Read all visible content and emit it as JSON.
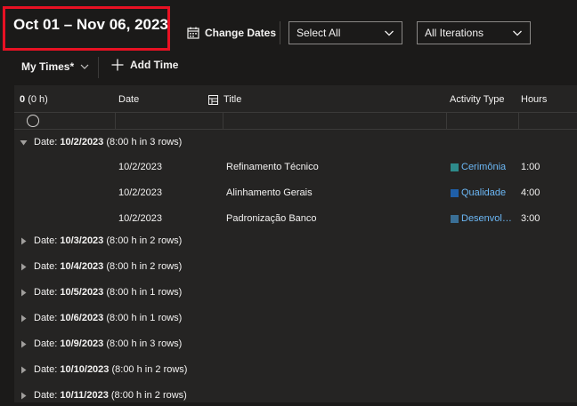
{
  "header": {
    "date_range": "Oct 01 – Nov 06, 2023",
    "change_dates_label": "Change Dates",
    "select_all_label": "Select All",
    "iterations_label": "All Iterations"
  },
  "command_bar": {
    "my_times_label": "My Times*",
    "add_time_label": "Add Time"
  },
  "grid": {
    "header": {
      "count_value": "0",
      "count_hours": "(0 h)",
      "date": "Date",
      "title": "Title",
      "activity_type": "Activity Type",
      "hours": "Hours"
    },
    "groups": [
      {
        "prefix": "Date: ",
        "date": "10/2/2023",
        "summary": " (8:00 h in 3 rows)",
        "expanded": true,
        "items": [
          {
            "date": "10/2/2023",
            "title": "Refinamento Técnico",
            "activity": "Cerimônia",
            "activity_color": "#2e8b8b",
            "hours": "1:00"
          },
          {
            "date": "10/2/2023",
            "title": "Alinhamento Gerais",
            "activity": "Qualidade",
            "activity_color": "#1f5fa8",
            "hours": "4:00"
          },
          {
            "date": "10/2/2023",
            "title": "Padronização Banco",
            "activity": "Desenvolv…",
            "activity_color": "#3a6f96",
            "hours": "3:00"
          }
        ]
      },
      {
        "prefix": "Date: ",
        "date": "10/3/2023",
        "summary": " (8:00 h in 2 rows)",
        "expanded": false
      },
      {
        "prefix": "Date: ",
        "date": "10/4/2023",
        "summary": " (8:00 h in 2 rows)",
        "expanded": false
      },
      {
        "prefix": "Date: ",
        "date": "10/5/2023",
        "summary": " (8:00 h in 1 rows)",
        "expanded": false
      },
      {
        "prefix": "Date: ",
        "date": "10/6/2023",
        "summary": " (8:00 h in 1 rows)",
        "expanded": false
      },
      {
        "prefix": "Date: ",
        "date": "10/9/2023",
        "summary": " (8:00 h in 3 rows)",
        "expanded": false
      },
      {
        "prefix": "Date: ",
        "date": "10/10/2023",
        "summary": " (8:00 h in 2 rows)",
        "expanded": false
      },
      {
        "prefix": "Date: ",
        "date": "10/11/2023",
        "summary": " (8:00 h in 2 rows)",
        "expanded": false
      }
    ]
  },
  "icons": {
    "calendar": "calendar-icon",
    "chevron": "chevron-down-icon",
    "plus": "plus-icon",
    "title_column": "column-options-icon",
    "expand": "triangle-right-icon",
    "collapse": "triangle-down-icon"
  }
}
